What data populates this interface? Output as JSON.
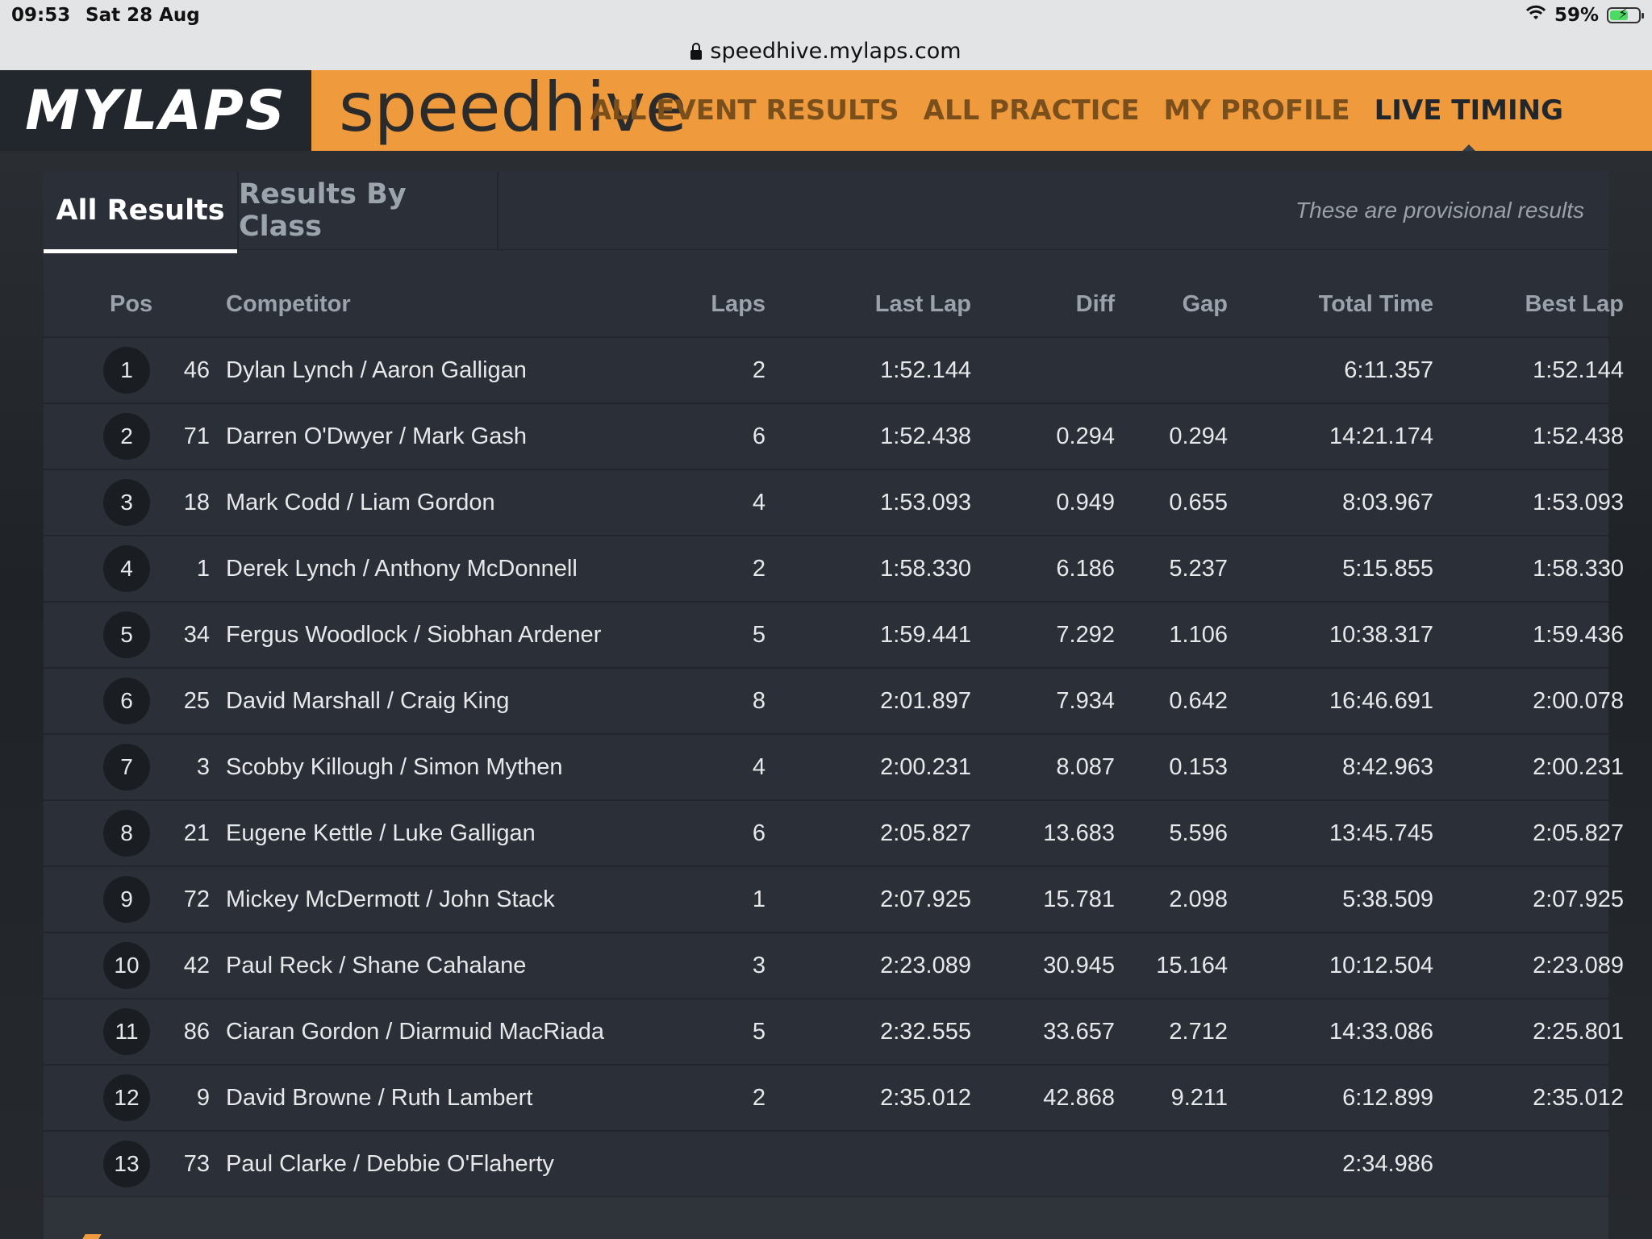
{
  "status_bar": {
    "time": "09:53",
    "date": "Sat 28 Aug",
    "battery": "59%"
  },
  "url_bar": {
    "domain": "speedhive.mylaps.com"
  },
  "header": {
    "brand_mylaps": "MYLAPS",
    "brand_speedhive": "speedhive",
    "nav": [
      {
        "label": "ALL EVENT RESULTS"
      },
      {
        "label": "ALL PRACTICE"
      },
      {
        "label": "MY PROFILE"
      },
      {
        "label": "LIVE TIMING"
      }
    ],
    "active_nav": "LIVE TIMING"
  },
  "tabs": [
    {
      "label": "All Results"
    },
    {
      "label": "Results By Class"
    }
  ],
  "notice": "These are provisional results",
  "table": {
    "columns": {
      "pos": "Pos",
      "competitor": "Competitor",
      "laps": "Laps",
      "last_lap": "Last Lap",
      "diff": "Diff",
      "gap": "Gap",
      "total_time": "Total Time",
      "best_lap": "Best Lap"
    },
    "rows": [
      {
        "pos": "1",
        "num": "46",
        "competitor": "Dylan Lynch / Aaron Galligan",
        "laps": "2",
        "last_lap": "1:52.144",
        "diff": "",
        "gap": "",
        "total_time": "6:11.357",
        "best_lap": "1:52.144"
      },
      {
        "pos": "2",
        "num": "71",
        "competitor": "Darren O'Dwyer / Mark Gash",
        "laps": "6",
        "last_lap": "1:52.438",
        "diff": "0.294",
        "gap": "0.294",
        "total_time": "14:21.174",
        "best_lap": "1:52.438"
      },
      {
        "pos": "3",
        "num": "18",
        "competitor": "Mark Codd / Liam Gordon",
        "laps": "4",
        "last_lap": "1:53.093",
        "diff": "0.949",
        "gap": "0.655",
        "total_time": "8:03.967",
        "best_lap": "1:53.093"
      },
      {
        "pos": "4",
        "num": "1",
        "competitor": "Derek Lynch / Anthony McDonnell",
        "laps": "2",
        "last_lap": "1:58.330",
        "diff": "6.186",
        "gap": "5.237",
        "total_time": "5:15.855",
        "best_lap": "1:58.330"
      },
      {
        "pos": "5",
        "num": "34",
        "competitor": "Fergus Woodlock / Siobhan Ardener",
        "laps": "5",
        "last_lap": "1:59.441",
        "diff": "7.292",
        "gap": "1.106",
        "total_time": "10:38.317",
        "best_lap": "1:59.436"
      },
      {
        "pos": "6",
        "num": "25",
        "competitor": "David Marshall / Craig King",
        "laps": "8",
        "last_lap": "2:01.897",
        "diff": "7.934",
        "gap": "0.642",
        "total_time": "16:46.691",
        "best_lap": "2:00.078"
      },
      {
        "pos": "7",
        "num": "3",
        "competitor": "Scobby Killough / Simon Mythen",
        "laps": "4",
        "last_lap": "2:00.231",
        "diff": "8.087",
        "gap": "0.153",
        "total_time": "8:42.963",
        "best_lap": "2:00.231"
      },
      {
        "pos": "8",
        "num": "21",
        "competitor": "Eugene Kettle / Luke Galligan",
        "laps": "6",
        "last_lap": "2:05.827",
        "diff": "13.683",
        "gap": "5.596",
        "total_time": "13:45.745",
        "best_lap": "2:05.827"
      },
      {
        "pos": "9",
        "num": "72",
        "competitor": "Mickey McDermott / John Stack",
        "laps": "1",
        "last_lap": "2:07.925",
        "diff": "15.781",
        "gap": "2.098",
        "total_time": "5:38.509",
        "best_lap": "2:07.925"
      },
      {
        "pos": "10",
        "num": "42",
        "competitor": "Paul Reck / Shane Cahalane",
        "laps": "3",
        "last_lap": "2:23.089",
        "diff": "30.945",
        "gap": "15.164",
        "total_time": "10:12.504",
        "best_lap": "2:23.089"
      },
      {
        "pos": "11",
        "num": "86",
        "competitor": "Ciaran Gordon / Diarmuid MacRiada",
        "laps": "5",
        "last_lap": "2:32.555",
        "diff": "33.657",
        "gap": "2.712",
        "total_time": "14:33.086",
        "best_lap": "2:25.801"
      },
      {
        "pos": "12",
        "num": "9",
        "competitor": "David Browne / Ruth Lambert",
        "laps": "2",
        "last_lap": "2:35.012",
        "diff": "42.868",
        "gap": "9.211",
        "total_time": "6:12.899",
        "best_lap": "2:35.012"
      },
      {
        "pos": "13",
        "num": "73",
        "competitor": "Paul Clarke / Debbie O'Flaherty",
        "laps": "",
        "last_lap": "",
        "diff": "",
        "gap": "",
        "total_time": "2:34.986",
        "best_lap": ""
      }
    ]
  },
  "colors": {
    "accent": "#ef9a3c",
    "brand_dark": "#22272d",
    "panel": "#2b3038"
  }
}
